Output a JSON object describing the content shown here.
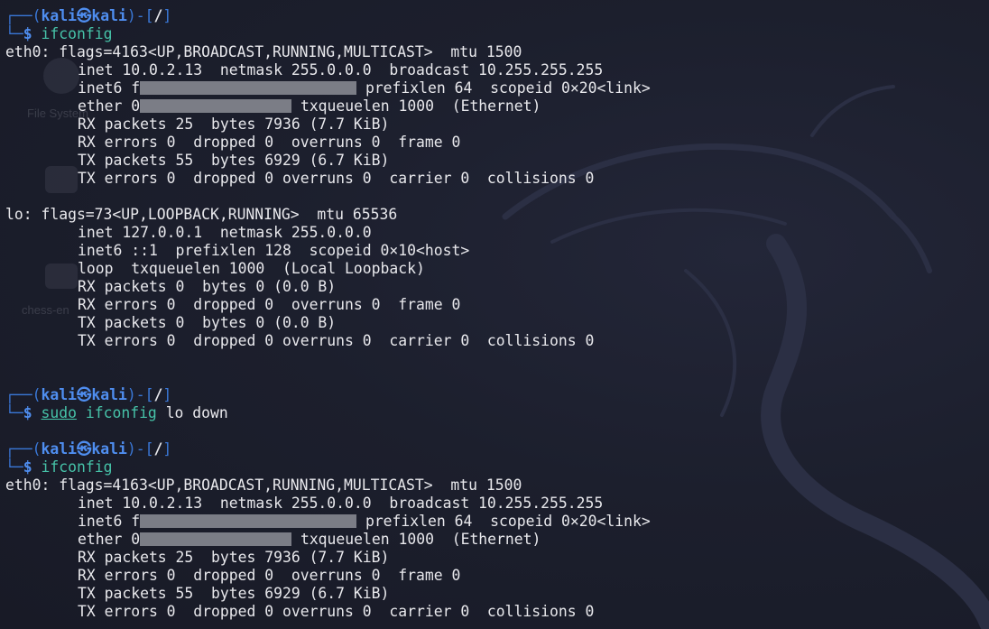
{
  "prompt": {
    "user": "kali",
    "host": "kali",
    "skull": "㉿",
    "dir": "/",
    "symbol": "$"
  },
  "commands": {
    "first": "ifconfig",
    "second_sudo": "sudo",
    "second_cmd": "ifconfig",
    "second_args": "lo down",
    "third": "ifconfig"
  },
  "eth0": {
    "header": "eth0: flags=4163<UP,BROADCAST,RUNNING,MULTICAST>  mtu 1500",
    "inet": "inet 10.0.2.13  netmask 255.0.0.0  broadcast 10.255.255.255",
    "inet6_prefix": "inet6 f",
    "inet6_suffix": " prefixlen 64  scopeid 0×20<link>",
    "ether_prefix": "ether 0",
    "ether_suffix": " txqueuelen 1000  (Ethernet)",
    "rx_packets": "RX packets 25  bytes 7936 (7.7 KiB)",
    "rx_errors": "RX errors 0  dropped 0  overruns 0  frame 0",
    "tx_packets": "TX packets 55  bytes 6929 (6.7 KiB)",
    "tx_errors": "TX errors 0  dropped 0 overruns 0  carrier 0  collisions 0"
  },
  "lo": {
    "header": "lo: flags=73<UP,LOOPBACK,RUNNING>  mtu 65536",
    "inet": "inet 127.0.0.1  netmask 255.0.0.0",
    "inet6": "inet6 ::1  prefixlen 128  scopeid 0×10<host>",
    "loop": "loop  txqueuelen 1000  (Local Loopback)",
    "rx_packets": "RX packets 0  bytes 0 (0.0 B)",
    "rx_errors": "RX errors 0  dropped 0  overruns 0  frame 0",
    "tx_packets": "TX packets 0  bytes 0 (0.0 B)",
    "tx_errors": "TX errors 0  dropped 0 overruns 0  carrier 0  collisions 0"
  },
  "desktop_ghost": {
    "file_system_label": "File System",
    "chess_label": "chess-en"
  },
  "colors": {
    "background": "#1c1f2d",
    "prompt_frame": "#3a78d8",
    "prompt_user": "#4f8ef0",
    "command": "#46c2a8",
    "text": "#e8e8ec",
    "redaction": "#7b7d86"
  }
}
